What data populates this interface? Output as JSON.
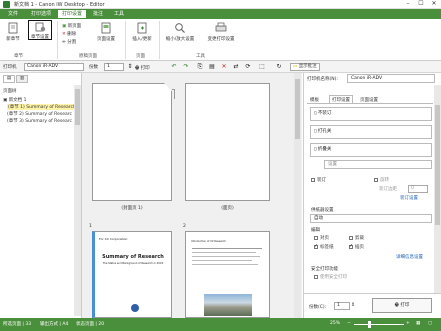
{
  "window": {
    "title": "新文档 1 - Canon iW Desktop - Editor",
    "min": "–",
    "max": "☐",
    "close": "✕"
  },
  "menu": {
    "items": [
      "文件",
      "打印选项",
      "打印设置",
      "批注",
      "工具"
    ],
    "active": 2
  },
  "ribbon": {
    "groups": [
      {
        "name": "章节",
        "label": "章节"
      },
      {
        "name": "原稿页面",
        "label": "原稿页面"
      },
      {
        "name": "页面",
        "label": "页面"
      },
      {
        "name": "工具",
        "label": "工具"
      }
    ],
    "buttons": {
      "new_chapter": "新章节",
      "set_chapter": "章节设置",
      "new_page": "新页面",
      "delete": "删除",
      "split": "分割",
      "doc_page": "页面设置",
      "insert_replace": "插入/更新",
      "thumbnail": "缩小/放大设置",
      "change_print": "变更打印设置"
    }
  },
  "toolbar": {
    "printer_label": "打印机",
    "printer_value": "Canon iR-ADV",
    "copies_label": "份数",
    "copies_value": "1",
    "print_btn": "打印",
    "show_anno": "显示批注"
  },
  "leftpane": {
    "tab_label": "页面树",
    "root": "新文档 1",
    "chapters": [
      "(章节 1) Summary of Research",
      "(章节 2) Summary of Researc",
      "(章节 3) Summary of Researc"
    ]
  },
  "midpane": {
    "pages_top": [
      {
        "caption": "(封面页 1)"
      },
      {
        "caption": "(面页)"
      }
    ],
    "pages_bottom": [
      {
        "num": "1",
        "line1": "For XX Corporation",
        "title": "Summary of Research",
        "sub": "The Status and Background of Research in 20XX"
      },
      {
        "num": "2",
        "line1": "Introduction of XX Research",
        "title": "",
        "sub": ""
      }
    ]
  },
  "rightpane": {
    "printer_label": "打印机名称(N):",
    "printer_value": "Canon iR-ADV",
    "tabs": [
      "模板",
      "打印设置",
      "页面设置"
    ],
    "active_tab": 1,
    "binding": "不装订",
    "punch": "打孔关",
    "folding": "折叠关",
    "folding_sub": "设置",
    "staple": "装订",
    "rotate": "旋转",
    "bind_margin_label": "装订边距",
    "bind_margin_val": "0",
    "detail_link": "装订设置",
    "finish_label": "供纸器设置",
    "finish_value": "自动",
    "paper_label": "编辑",
    "opt_2up": "对页",
    "opt_margin": "剪裁",
    "opt_label": "标签纸",
    "opt_insert": "插页",
    "detail_link2": "详细信息设置",
    "secure_label": "安全打印功能",
    "secure_opt": "使用安全打印",
    "copies_label": "份数(C):",
    "copies_value": "1",
    "print_btn": "打印"
  },
  "status": {
    "pages": "所选页面 | 33",
    "layout": "输出方式 | A4",
    "status": "状态页面 | 20",
    "zoom": "25%"
  }
}
